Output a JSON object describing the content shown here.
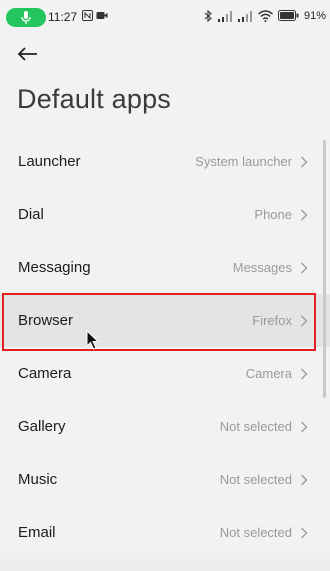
{
  "status_bar": {
    "time": "11:27",
    "battery_percent": "91",
    "mic_pill_color": "#23c55e"
  },
  "header": {
    "title": "Default apps"
  },
  "apps": [
    {
      "label": "Launcher",
      "value": "System launcher"
    },
    {
      "label": "Dial",
      "value": "Phone"
    },
    {
      "label": "Messaging",
      "value": "Messages"
    },
    {
      "label": "Browser",
      "value": "Firefox"
    },
    {
      "label": "Camera",
      "value": "Camera"
    },
    {
      "label": "Gallery",
      "value": "Not selected"
    },
    {
      "label": "Music",
      "value": "Not selected"
    },
    {
      "label": "Email",
      "value": "Not selected"
    }
  ],
  "highlight_color": "#e02020"
}
